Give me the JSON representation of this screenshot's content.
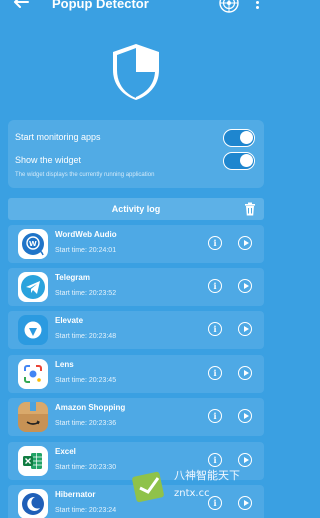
{
  "app_bar": {
    "title": "Popup Detector",
    "back_icon": "arrow-left-icon",
    "radar_icon": "radar-icon",
    "menu_icon": "more-vert-icon"
  },
  "hero": {
    "icon": "shield-icon"
  },
  "settings": {
    "monitoring_label": "Start monitoring apps",
    "monitoring_on": true,
    "widget_label": "Show the widget",
    "widget_on": true,
    "widget_note": "The widget displays the currently running application"
  },
  "activity_log": {
    "title": "Activity log",
    "clear_icon": "trash-icon",
    "items": [
      {
        "name": "WordWeb Audio",
        "start_time": "Start time:  20:24:01",
        "icon": "wordweb-icon"
      },
      {
        "name": "Telegram",
        "start_time": "Start time:  20:23:52",
        "icon": "telegram-icon"
      },
      {
        "name": "Elevate",
        "start_time": "Start time:  20:23:48",
        "icon": "elevate-icon"
      },
      {
        "name": "Lens",
        "start_time": "Start time:  20:23:45",
        "icon": "lens-icon"
      },
      {
        "name": "Amazon Shopping",
        "start_time": "Start time:  20:23:36",
        "icon": "amazon-icon"
      },
      {
        "name": "Excel",
        "start_time": "Start time:  20:23:30",
        "icon": "excel-icon"
      },
      {
        "name": "Hibernator",
        "start_time": "Start time:  20:23:24",
        "icon": "hibernator-icon"
      }
    ]
  },
  "watermark": {
    "line1": "八神智能天下",
    "line2": "zntx.cc"
  },
  "colors": {
    "background": "#3aa0e2",
    "toggle_track": "#1e86cf"
  }
}
